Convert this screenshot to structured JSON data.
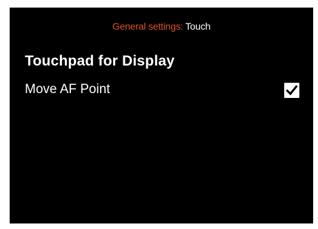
{
  "header": {
    "prefix": "General settings:",
    "current": "Touch",
    "prefix_color": "#d9522c"
  },
  "section": {
    "title": "Touchpad for Display"
  },
  "settings": [
    {
      "label": "Move AF Point",
      "checked": true,
      "icon": "checkmark-icon"
    }
  ]
}
